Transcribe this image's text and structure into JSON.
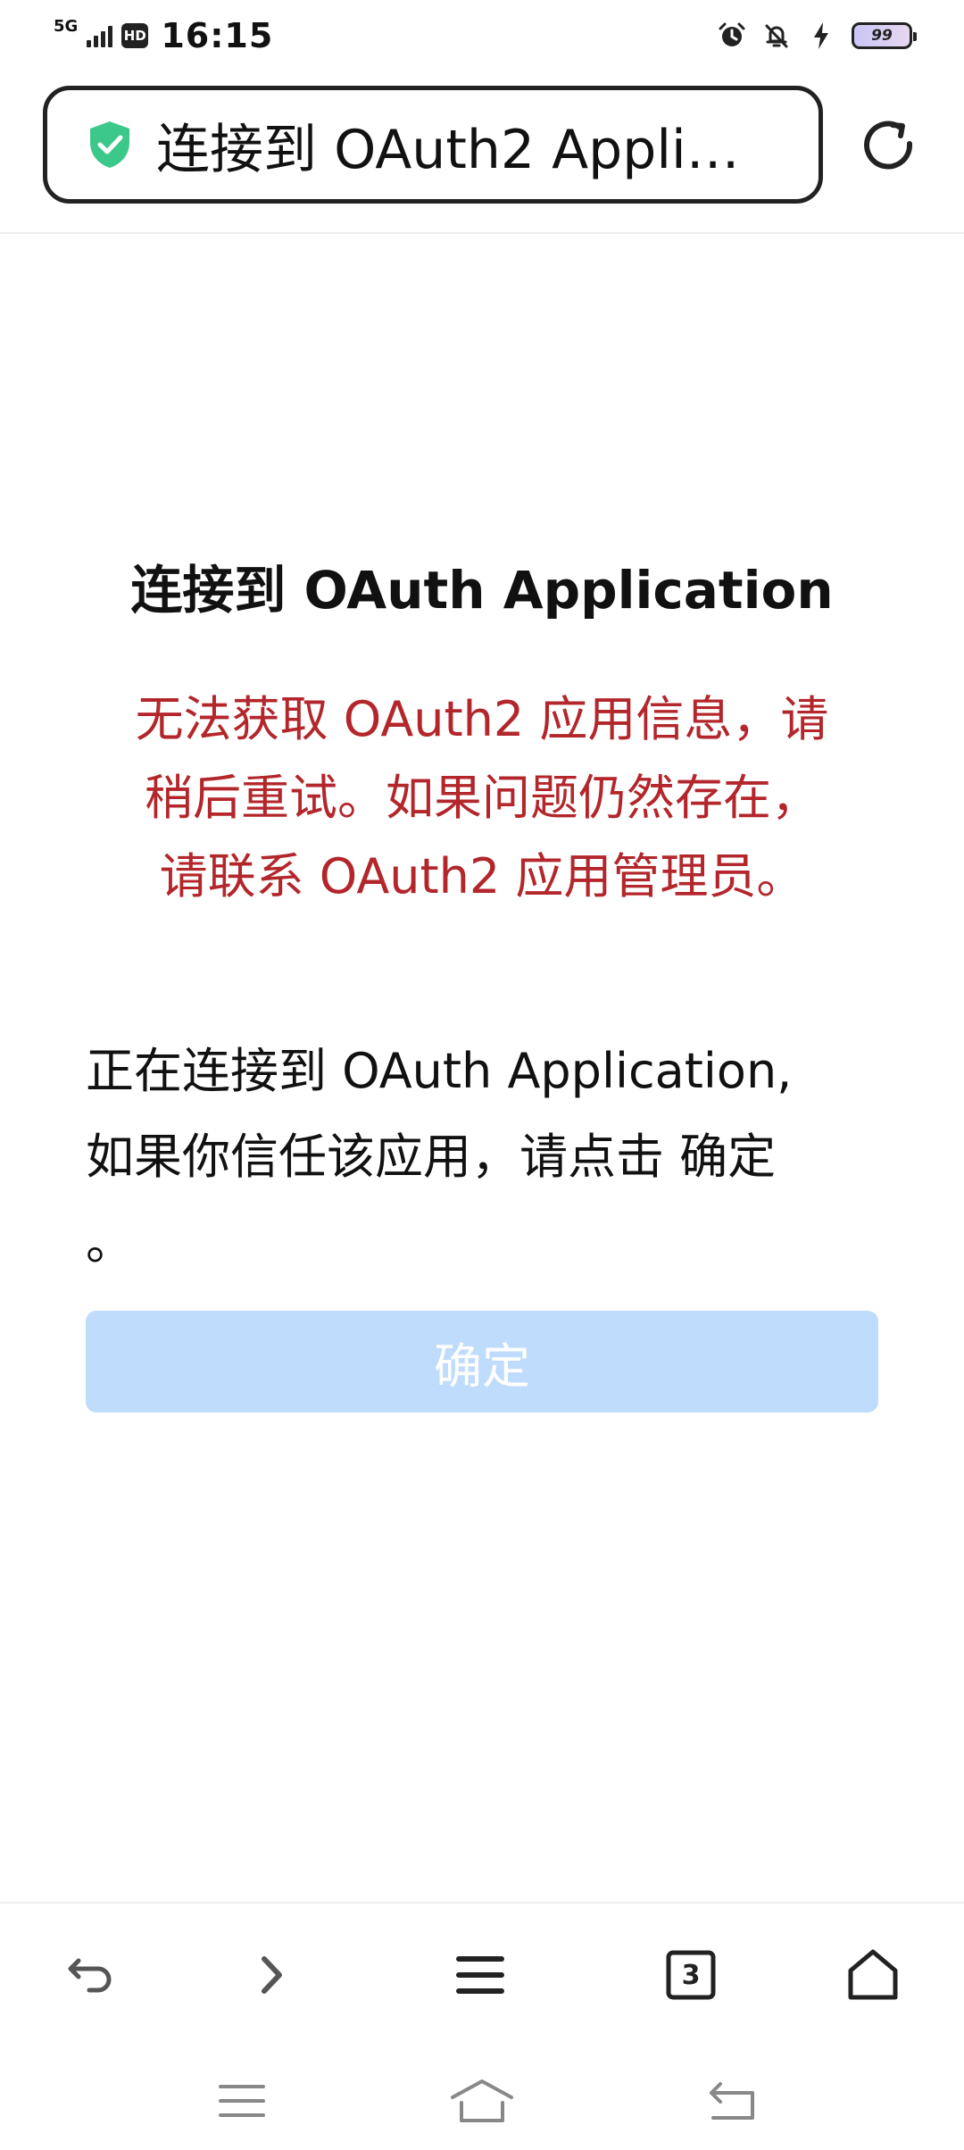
{
  "status_bar": {
    "network": "5G",
    "hd": "HD",
    "time": "16:15",
    "battery": "99",
    "icons": [
      "alarm-icon",
      "bell-off-icon",
      "charging-icon"
    ]
  },
  "address_bar": {
    "text": "连接到 OAuth2 Appli…",
    "secure_icon": "shield-check-icon",
    "secure_color": "#3cc88a"
  },
  "main": {
    "title": "连接到 OAuth Application",
    "error_lines": [
      "无法获取 OAuth2 应用信息，请",
      "稍后重试。如果问题仍然存在，",
      "请联系 OAuth2 应用管理员。"
    ],
    "info_lines": [
      "正在连接到 OAuth Application,",
      "如果你信任该应用，请点击 确定",
      "。"
    ],
    "confirm_label": "确定",
    "error_color": "#b3262b",
    "button_color": "#bfdcfd"
  },
  "toolbar": {
    "tab_count": "3",
    "icons": [
      "back-icon",
      "forward-icon",
      "menu-icon",
      "tabs-icon",
      "home-icon"
    ]
  },
  "system_nav": {
    "icons": [
      "recent-apps-icon",
      "system-home-icon",
      "system-back-icon"
    ]
  }
}
